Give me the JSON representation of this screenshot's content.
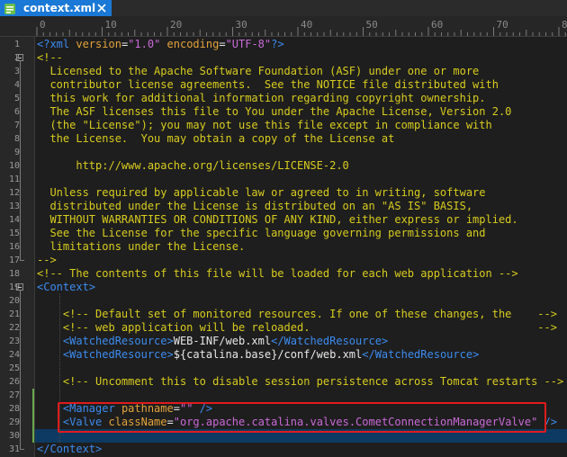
{
  "tab": {
    "label": "context.xml"
  },
  "ruler": {
    "labels": [
      {
        "text": "0",
        "col": 0
      },
      {
        "text": "10",
        "col": 10
      },
      {
        "text": "20",
        "col": 20
      },
      {
        "text": "30",
        "col": 30
      },
      {
        "text": "40",
        "col": 40
      },
      {
        "text": "50",
        "col": 50
      },
      {
        "text": "60",
        "col": 60
      },
      {
        "text": "70",
        "col": 70
      },
      {
        "text": "80",
        "col": 80
      }
    ]
  },
  "lines": [
    {
      "n": "1",
      "seg": [
        [
          "tg",
          "<?xml "
        ],
        [
          "at",
          "version"
        ],
        [
          "tx",
          "="
        ],
        [
          "vl",
          "\"1.0\""
        ],
        [
          "tx",
          " "
        ],
        [
          "at",
          "encoding"
        ],
        [
          "tx",
          "="
        ],
        [
          "vl",
          "\"UTF-8\""
        ],
        [
          "tg",
          "?>"
        ]
      ]
    },
    {
      "n": "2",
      "seg": [
        [
          "cm",
          "<!--"
        ]
      ]
    },
    {
      "n": "3",
      "seg": [
        [
          "cm",
          "  Licensed to the Apache Software Foundation (ASF) under one or more"
        ]
      ]
    },
    {
      "n": "4",
      "seg": [
        [
          "cm",
          "  contributor license agreements.  See the NOTICE file distributed with"
        ]
      ]
    },
    {
      "n": "5",
      "seg": [
        [
          "cm",
          "  this work for additional information regarding copyright ownership."
        ]
      ]
    },
    {
      "n": "6",
      "seg": [
        [
          "cm",
          "  The ASF licenses this file to You under the Apache License, Version 2.0"
        ]
      ]
    },
    {
      "n": "7",
      "seg": [
        [
          "cm",
          "  (the \"License\"); you may not use this file except in compliance with"
        ]
      ]
    },
    {
      "n": "8",
      "seg": [
        [
          "cm",
          "  the License.  You may obtain a copy of the License at"
        ]
      ]
    },
    {
      "n": "9",
      "seg": [
        [
          "cm",
          ""
        ]
      ]
    },
    {
      "n": "10",
      "seg": [
        [
          "cm",
          "      http://www.apache.org/licenses/LICENSE-2.0"
        ]
      ]
    },
    {
      "n": "11",
      "seg": [
        [
          "cm",
          ""
        ]
      ]
    },
    {
      "n": "12",
      "seg": [
        [
          "cm",
          "  Unless required by applicable law or agreed to in writing, software"
        ]
      ]
    },
    {
      "n": "13",
      "seg": [
        [
          "cm",
          "  distributed under the License is distributed on an \"AS IS\" BASIS,"
        ]
      ]
    },
    {
      "n": "14",
      "seg": [
        [
          "cm",
          "  WITHOUT WARRANTIES OR CONDITIONS OF ANY KIND, either express or implied."
        ]
      ]
    },
    {
      "n": "15",
      "seg": [
        [
          "cm",
          "  See the License for the specific language governing permissions and"
        ]
      ]
    },
    {
      "n": "16",
      "seg": [
        [
          "cm",
          "  limitations under the License."
        ]
      ]
    },
    {
      "n": "17",
      "seg": [
        [
          "cm",
          "-->"
        ]
      ]
    },
    {
      "n": "18",
      "seg": [
        [
          "cm",
          "<!-- The contents of this file will be loaded for each web application -->"
        ]
      ]
    },
    {
      "n": "19",
      "seg": [
        [
          "tg",
          "<Context>"
        ]
      ]
    },
    {
      "n": "20",
      "seg": [
        [
          "tx",
          ""
        ]
      ]
    },
    {
      "n": "21",
      "seg": [
        [
          "cm",
          "    <!-- Default set of monitored resources. If one of these changes, the    -->"
        ]
      ]
    },
    {
      "n": "22",
      "seg": [
        [
          "cm",
          "    <!-- web application will be reloaded.                                   -->"
        ]
      ]
    },
    {
      "n": "23",
      "seg": [
        [
          "tx",
          "    "
        ],
        [
          "tg",
          "<WatchedResource>"
        ],
        [
          "tx",
          "WEB-INF/web.xml"
        ],
        [
          "tg",
          "</WatchedResource>"
        ]
      ]
    },
    {
      "n": "24",
      "seg": [
        [
          "tx",
          "    "
        ],
        [
          "tg",
          "<WatchedResource>"
        ],
        [
          "tx",
          "${catalina.base}/conf/web.xml"
        ],
        [
          "tg",
          "</WatchedResource>"
        ]
      ]
    },
    {
      "n": "25",
      "seg": [
        [
          "tx",
          ""
        ]
      ]
    },
    {
      "n": "26",
      "seg": [
        [
          "cm",
          "    <!-- Uncomment this to disable session persistence across Tomcat restarts -->"
        ]
      ]
    },
    {
      "n": "27",
      "seg": [
        [
          "tx",
          ""
        ]
      ]
    },
    {
      "n": "28",
      "seg": [
        [
          "tx",
          "    "
        ],
        [
          "tg",
          "<Manager "
        ],
        [
          "at",
          "pathname"
        ],
        [
          "tx",
          "="
        ],
        [
          "vl",
          "\"\""
        ],
        [
          "tx",
          " "
        ],
        [
          "tg",
          "/>"
        ]
      ]
    },
    {
      "n": "29",
      "seg": [
        [
          "tx",
          "    "
        ],
        [
          "tg",
          "<Valve "
        ],
        [
          "at",
          "className"
        ],
        [
          "tx",
          "="
        ],
        [
          "vl",
          "\"org.apache.catalina.valves.CometConnectionManagerValve\""
        ],
        [
          "tx",
          " "
        ],
        [
          "tg",
          "/>"
        ]
      ]
    },
    {
      "n": "30",
      "seg": [
        [
          "tx",
          ""
        ]
      ]
    },
    {
      "n": "31",
      "seg": [
        [
          "tg",
          "</Context>"
        ]
      ]
    }
  ],
  "colors": {
    "tag": "#3c8cf0",
    "comment": "#d8cc1f",
    "attribute": "#e3a33b",
    "value": "#c96ad8",
    "highlight_box": "#e01b1b",
    "tab_active": "#1a78d6"
  }
}
